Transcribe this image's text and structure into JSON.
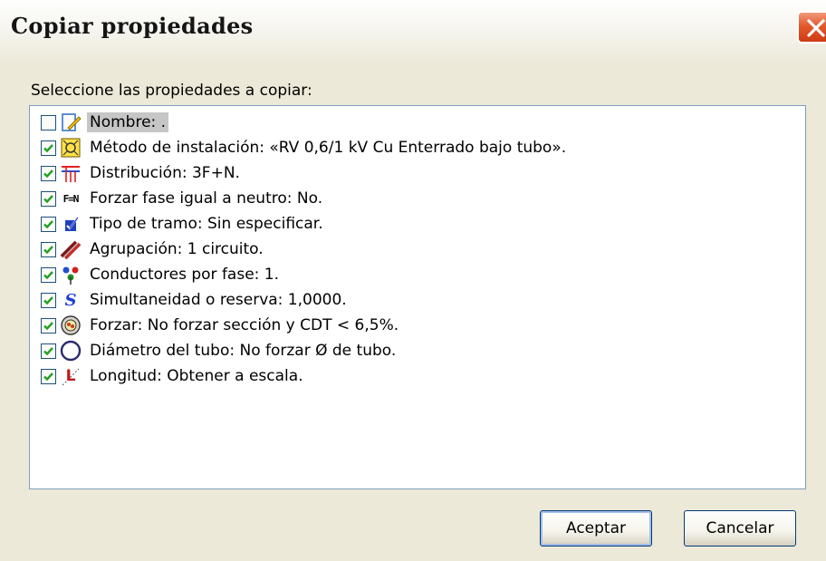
{
  "window": {
    "title": "Copiar propiedades"
  },
  "prompt": "Seleccione las propiedades a copiar:",
  "properties": [
    {
      "label": "Nombre: .",
      "checked": false,
      "icon": "name-icon",
      "selected": true
    },
    {
      "label": "Método de instalación: «RV 0,6/1 kV Cu Enterrado bajo tubo».",
      "checked": true,
      "icon": "installation-method-icon"
    },
    {
      "label": "Distribución: 3F+N.",
      "checked": true,
      "icon": "distribution-icon"
    },
    {
      "label": "Forzar fase igual a neutro: No.",
      "checked": true,
      "icon": "phase-neutral-icon",
      "icon_text": "F=N"
    },
    {
      "label": "Tipo de tramo: Sin especificar.",
      "checked": true,
      "icon": "section-type-icon"
    },
    {
      "label": "Agrupación: 1 circuito.",
      "checked": true,
      "icon": "grouping-icon"
    },
    {
      "label": "Conductores por fase: 1.",
      "checked": true,
      "icon": "conductors-icon"
    },
    {
      "label": "Simultaneidad o reserva: 1,0000.",
      "checked": true,
      "icon": "simultaneity-icon",
      "icon_text": "S"
    },
    {
      "label": "Forzar: No forzar sección y CDT < 6,5%.",
      "checked": true,
      "icon": "force-section-icon"
    },
    {
      "label": "Diámetro del tubo: No forzar Ø de tubo.",
      "checked": true,
      "icon": "tube-diameter-icon"
    },
    {
      "label": "Longitud: Obtener a escala.",
      "checked": true,
      "icon": "length-icon",
      "icon_text": "L"
    }
  ],
  "buttons": {
    "ok": "Aceptar",
    "cancel": "Cancelar"
  },
  "colors": {
    "dialog_bg": "#ece9d8",
    "selection": "#c6c6c6",
    "check": "#21a121",
    "close_red": "#e5592d"
  }
}
